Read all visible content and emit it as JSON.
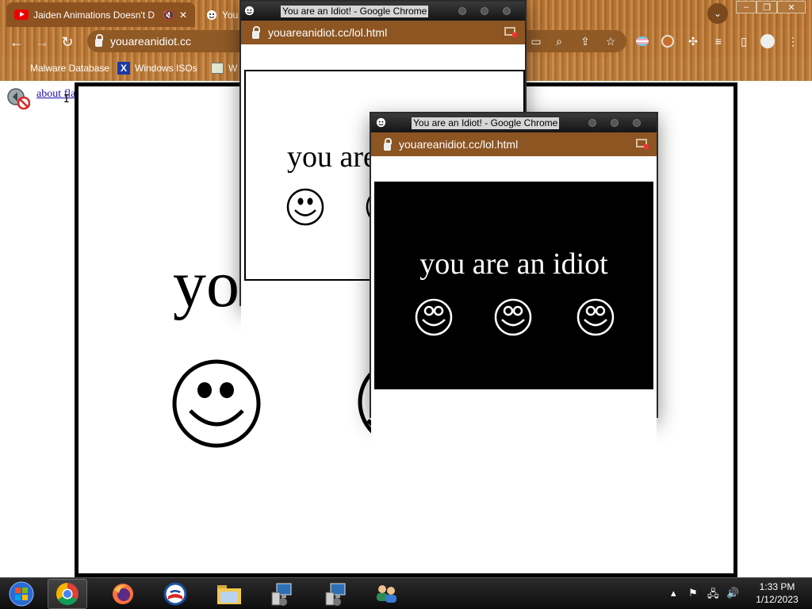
{
  "browser": {
    "tabs": [
      {
        "label": "Jaiden Animations Doesn't D",
        "icon": "youtube-icon",
        "audio": "🔇",
        "close": "✕"
      },
      {
        "label": "You",
        "icon": "smiley-favicon-icon"
      }
    ],
    "address": "youareanidiot.cc",
    "bookmarks": [
      {
        "label": "Malware Database"
      },
      {
        "label": "Windows ISOs"
      },
      {
        "label": "W"
      }
    ]
  },
  "page": {
    "about_flash_link": "about flash",
    "big_text": "yo"
  },
  "popups": [
    {
      "title": "You are an Idiot! - Google Chrome",
      "address": "youareanidiot.cc/lol.html",
      "body_text": "you are"
    },
    {
      "title": "You are an Idiot! - Google Chrome",
      "address": "youareanidiot.cc/lol.html",
      "body_text": "you are an idiot"
    }
  ],
  "taskbar": {
    "time": "1:33 PM",
    "date": "1/12/2023",
    "items": [
      "start-orb",
      "chrome",
      "firefox",
      "obama-icon",
      "file-explorer",
      "remote-desktop-1",
      "remote-desktop-2",
      "network-users"
    ]
  },
  "colors": {
    "chrome_theme": "#b87333",
    "popup_titlebar": "#1f1f1f"
  }
}
